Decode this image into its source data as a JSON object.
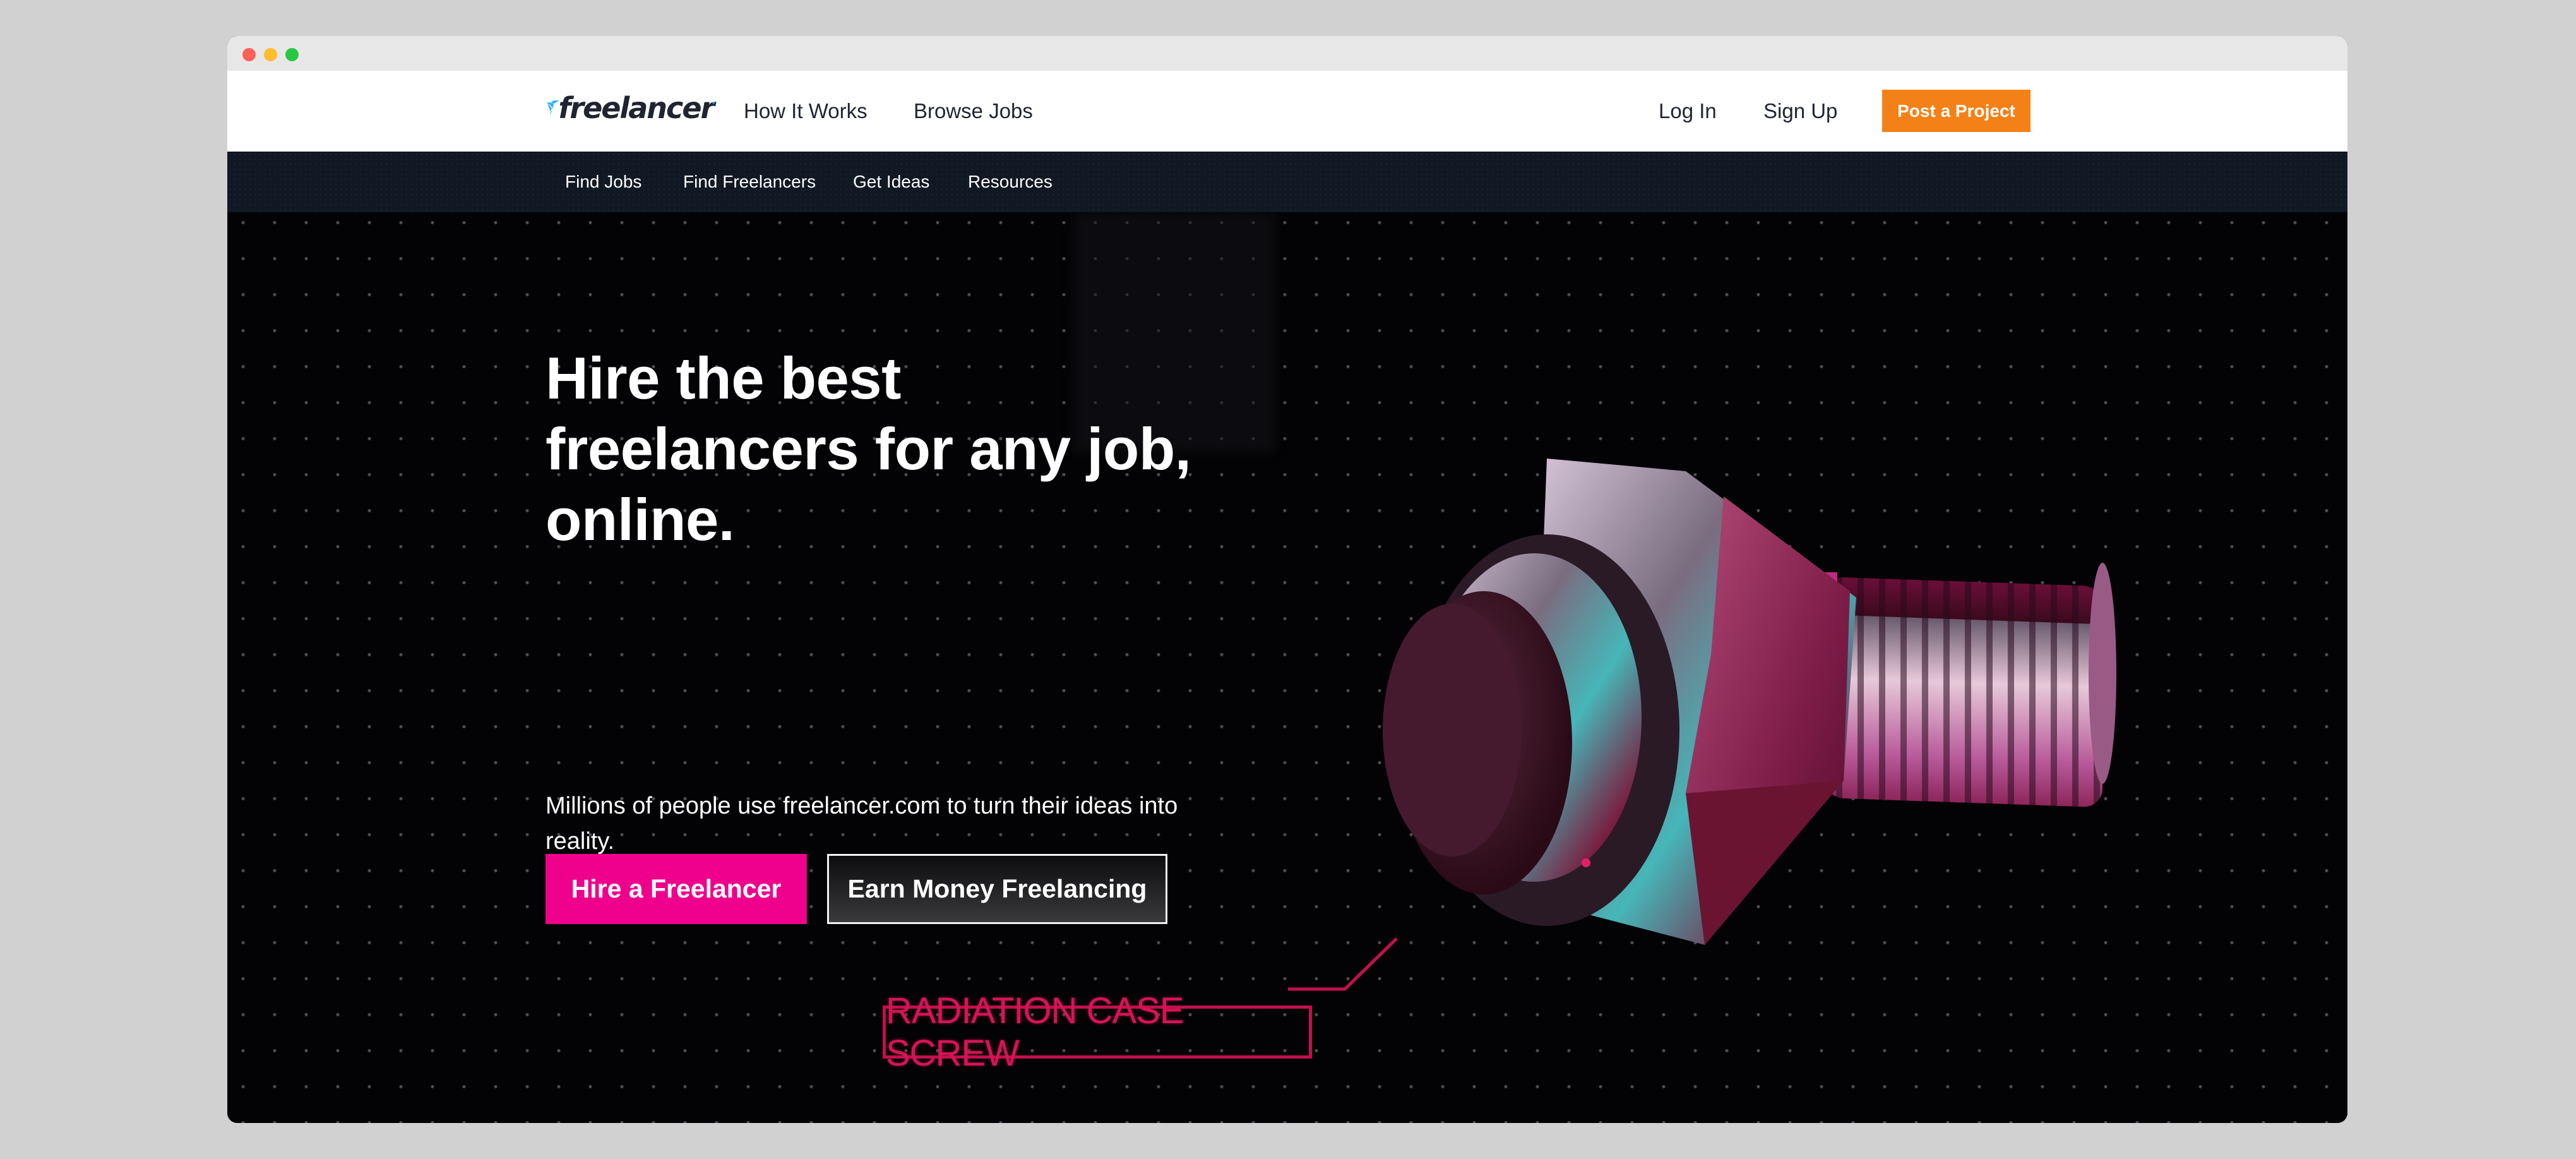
{
  "window": {
    "controls": [
      "close",
      "minimize",
      "maximize"
    ]
  },
  "header": {
    "logo_text": "freelancer",
    "logo_icon": "freelancer-bird-icon",
    "nav": [
      "How It Works",
      "Browse Jobs"
    ],
    "login_label": "Log In",
    "signup_label": "Sign Up",
    "post_project_label": "Post a Project"
  },
  "subnav": {
    "items": [
      "Find Jobs",
      "Find Freelancers",
      "Get Ideas",
      "Resources"
    ]
  },
  "hero": {
    "headline_lines": [
      "Hire the best",
      "freelancers for any job,",
      "online."
    ],
    "subtext": "Millions of people use freelancer.com to turn their ideas into reality.",
    "hire_button_label": "Hire a Freelancer",
    "earn_button_label": "Earn Money Freelancing",
    "image_label": "RADIATION CASE SCREW"
  },
  "colors": {
    "brand_blue": "#29b2fe",
    "post_orange": "#f48117",
    "hire_pink": "#ee008c",
    "subnav_bg": "#101823",
    "label_crimson": "#c3104f"
  }
}
